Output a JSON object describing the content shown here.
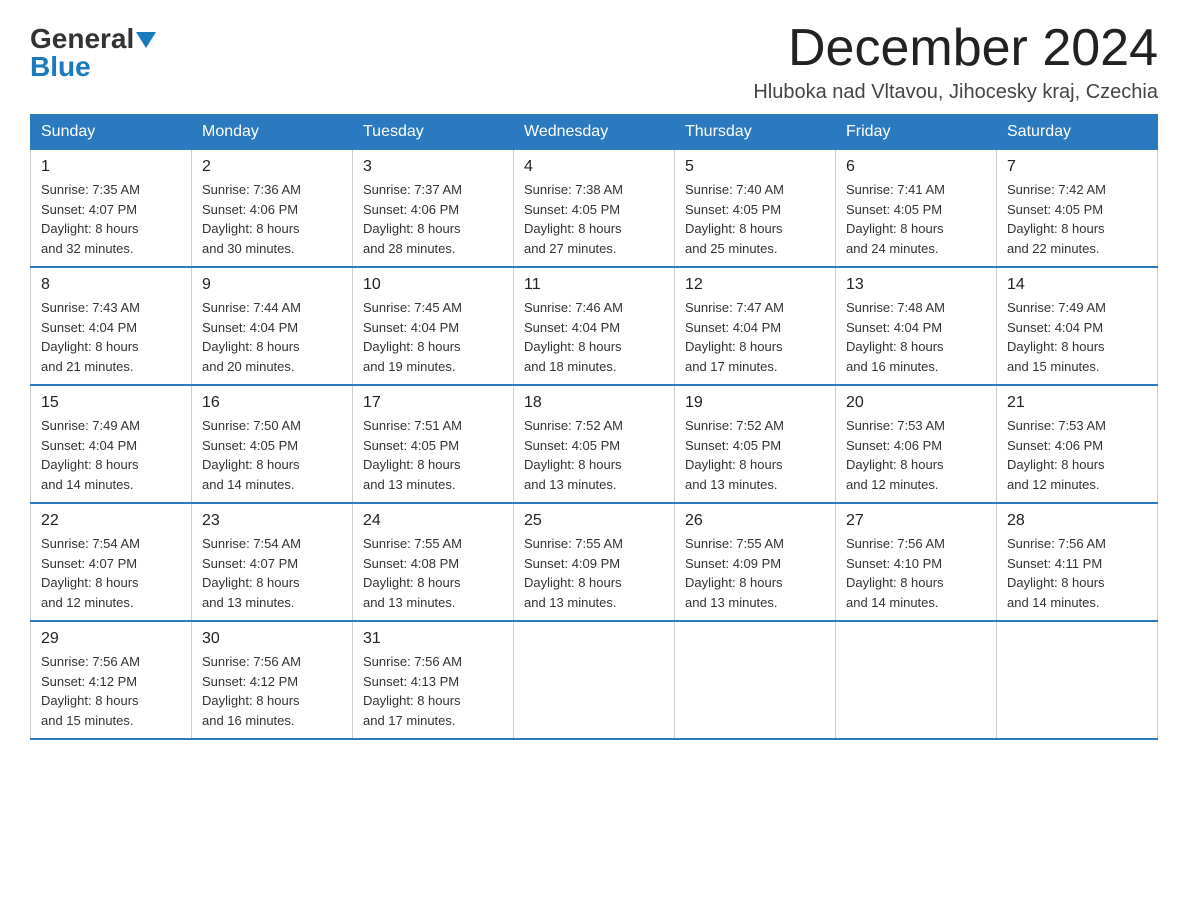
{
  "logo": {
    "general": "General",
    "blue": "Blue"
  },
  "title": "December 2024",
  "location": "Hluboka nad Vltavou, Jihocesky kraj, Czechia",
  "headers": [
    "Sunday",
    "Monday",
    "Tuesday",
    "Wednesday",
    "Thursday",
    "Friday",
    "Saturday"
  ],
  "weeks": [
    [
      {
        "day": "1",
        "sunrise": "7:35 AM",
        "sunset": "4:07 PM",
        "daylight": "8 hours and 32 minutes."
      },
      {
        "day": "2",
        "sunrise": "7:36 AM",
        "sunset": "4:06 PM",
        "daylight": "8 hours and 30 minutes."
      },
      {
        "day": "3",
        "sunrise": "7:37 AM",
        "sunset": "4:06 PM",
        "daylight": "8 hours and 28 minutes."
      },
      {
        "day": "4",
        "sunrise": "7:38 AM",
        "sunset": "4:05 PM",
        "daylight": "8 hours and 27 minutes."
      },
      {
        "day": "5",
        "sunrise": "7:40 AM",
        "sunset": "4:05 PM",
        "daylight": "8 hours and 25 minutes."
      },
      {
        "day": "6",
        "sunrise": "7:41 AM",
        "sunset": "4:05 PM",
        "daylight": "8 hours and 24 minutes."
      },
      {
        "day": "7",
        "sunrise": "7:42 AM",
        "sunset": "4:05 PM",
        "daylight": "8 hours and 22 minutes."
      }
    ],
    [
      {
        "day": "8",
        "sunrise": "7:43 AM",
        "sunset": "4:04 PM",
        "daylight": "8 hours and 21 minutes."
      },
      {
        "day": "9",
        "sunrise": "7:44 AM",
        "sunset": "4:04 PM",
        "daylight": "8 hours and 20 minutes."
      },
      {
        "day": "10",
        "sunrise": "7:45 AM",
        "sunset": "4:04 PM",
        "daylight": "8 hours and 19 minutes."
      },
      {
        "day": "11",
        "sunrise": "7:46 AM",
        "sunset": "4:04 PM",
        "daylight": "8 hours and 18 minutes."
      },
      {
        "day": "12",
        "sunrise": "7:47 AM",
        "sunset": "4:04 PM",
        "daylight": "8 hours and 17 minutes."
      },
      {
        "day": "13",
        "sunrise": "7:48 AM",
        "sunset": "4:04 PM",
        "daylight": "8 hours and 16 minutes."
      },
      {
        "day": "14",
        "sunrise": "7:49 AM",
        "sunset": "4:04 PM",
        "daylight": "8 hours and 15 minutes."
      }
    ],
    [
      {
        "day": "15",
        "sunrise": "7:49 AM",
        "sunset": "4:04 PM",
        "daylight": "8 hours and 14 minutes."
      },
      {
        "day": "16",
        "sunrise": "7:50 AM",
        "sunset": "4:05 PM",
        "daylight": "8 hours and 14 minutes."
      },
      {
        "day": "17",
        "sunrise": "7:51 AM",
        "sunset": "4:05 PM",
        "daylight": "8 hours and 13 minutes."
      },
      {
        "day": "18",
        "sunrise": "7:52 AM",
        "sunset": "4:05 PM",
        "daylight": "8 hours and 13 minutes."
      },
      {
        "day": "19",
        "sunrise": "7:52 AM",
        "sunset": "4:05 PM",
        "daylight": "8 hours and 13 minutes."
      },
      {
        "day": "20",
        "sunrise": "7:53 AM",
        "sunset": "4:06 PM",
        "daylight": "8 hours and 12 minutes."
      },
      {
        "day": "21",
        "sunrise": "7:53 AM",
        "sunset": "4:06 PM",
        "daylight": "8 hours and 12 minutes."
      }
    ],
    [
      {
        "day": "22",
        "sunrise": "7:54 AM",
        "sunset": "4:07 PM",
        "daylight": "8 hours and 12 minutes."
      },
      {
        "day": "23",
        "sunrise": "7:54 AM",
        "sunset": "4:07 PM",
        "daylight": "8 hours and 13 minutes."
      },
      {
        "day": "24",
        "sunrise": "7:55 AM",
        "sunset": "4:08 PM",
        "daylight": "8 hours and 13 minutes."
      },
      {
        "day": "25",
        "sunrise": "7:55 AM",
        "sunset": "4:09 PM",
        "daylight": "8 hours and 13 minutes."
      },
      {
        "day": "26",
        "sunrise": "7:55 AM",
        "sunset": "4:09 PM",
        "daylight": "8 hours and 13 minutes."
      },
      {
        "day": "27",
        "sunrise": "7:56 AM",
        "sunset": "4:10 PM",
        "daylight": "8 hours and 14 minutes."
      },
      {
        "day": "28",
        "sunrise": "7:56 AM",
        "sunset": "4:11 PM",
        "daylight": "8 hours and 14 minutes."
      }
    ],
    [
      {
        "day": "29",
        "sunrise": "7:56 AM",
        "sunset": "4:12 PM",
        "daylight": "8 hours and 15 minutes."
      },
      {
        "day": "30",
        "sunrise": "7:56 AM",
        "sunset": "4:12 PM",
        "daylight": "8 hours and 16 minutes."
      },
      {
        "day": "31",
        "sunrise": "7:56 AM",
        "sunset": "4:13 PM",
        "daylight": "8 hours and 17 minutes."
      },
      null,
      null,
      null,
      null
    ]
  ],
  "labels": {
    "sunrise": "Sunrise:",
    "sunset": "Sunset:",
    "daylight": "Daylight:"
  }
}
